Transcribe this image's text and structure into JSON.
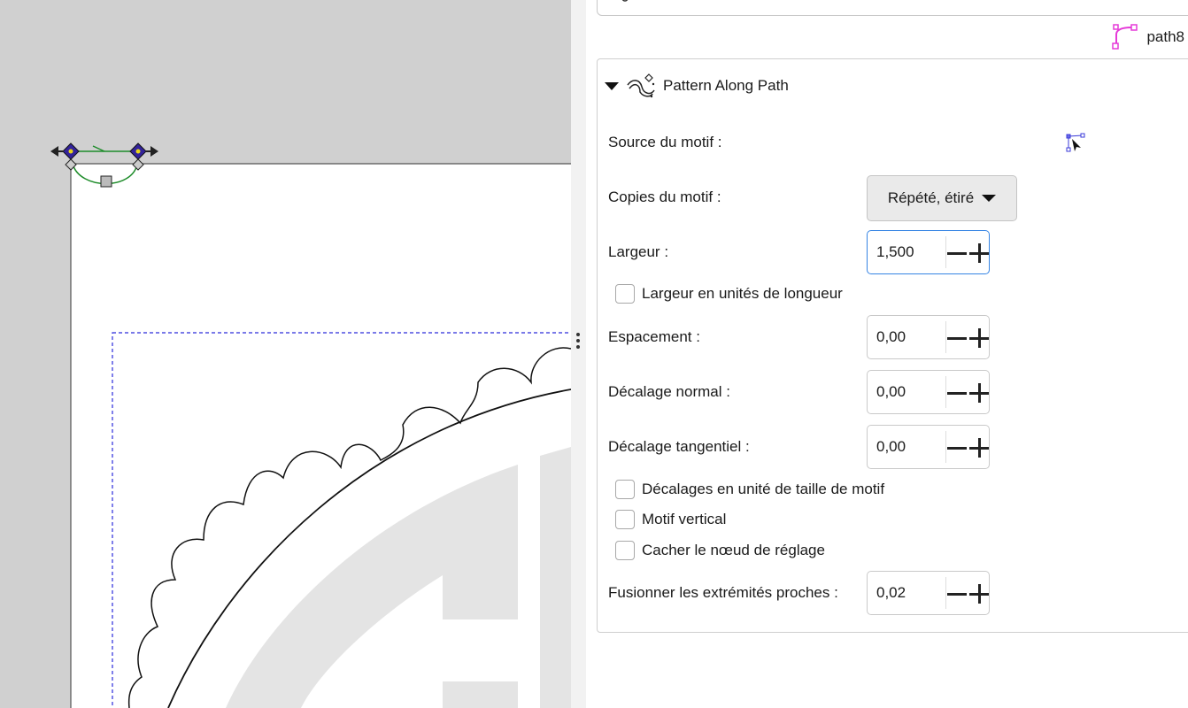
{
  "header": {
    "object_name": "path8",
    "object_icon": "bezier-path-icon"
  },
  "effect": {
    "title": "Pattern Along Path",
    "icon": "pattern-along-path-icon",
    "source": {
      "label": "Source du motif :",
      "button_icon": "node-edit-icon"
    },
    "copies": {
      "label": "Copies du motif :",
      "value": "Répété, étiré"
    },
    "width": {
      "label": "Largeur :",
      "value": "1,500"
    },
    "width_units": {
      "label": "Largeur en unités de longueur",
      "checked": false
    },
    "spacing": {
      "label": "Espacement :",
      "value": "0,00"
    },
    "normal_offset": {
      "label": "Décalage normal :",
      "value": "0,00"
    },
    "tangential_offset": {
      "label": "Décalage tangentiel :",
      "value": "0,00"
    },
    "offsets_pattern_units": {
      "label": "Décalages en unité de taille de motif",
      "checked": false
    },
    "vertical_pattern": {
      "label": "Motif vertical",
      "checked": false
    },
    "hide_knot": {
      "label": "Cacher le nœud de réglage",
      "checked": false
    },
    "fuse_nearby_ends": {
      "label": "Fusionner les extrémités proches :",
      "value": "0,02"
    }
  },
  "colors": {
    "focus": "#3584e4",
    "selection_box": "#2a2adb",
    "path_handle": "#1e8c2a",
    "node_icon": "#e53ad8"
  }
}
